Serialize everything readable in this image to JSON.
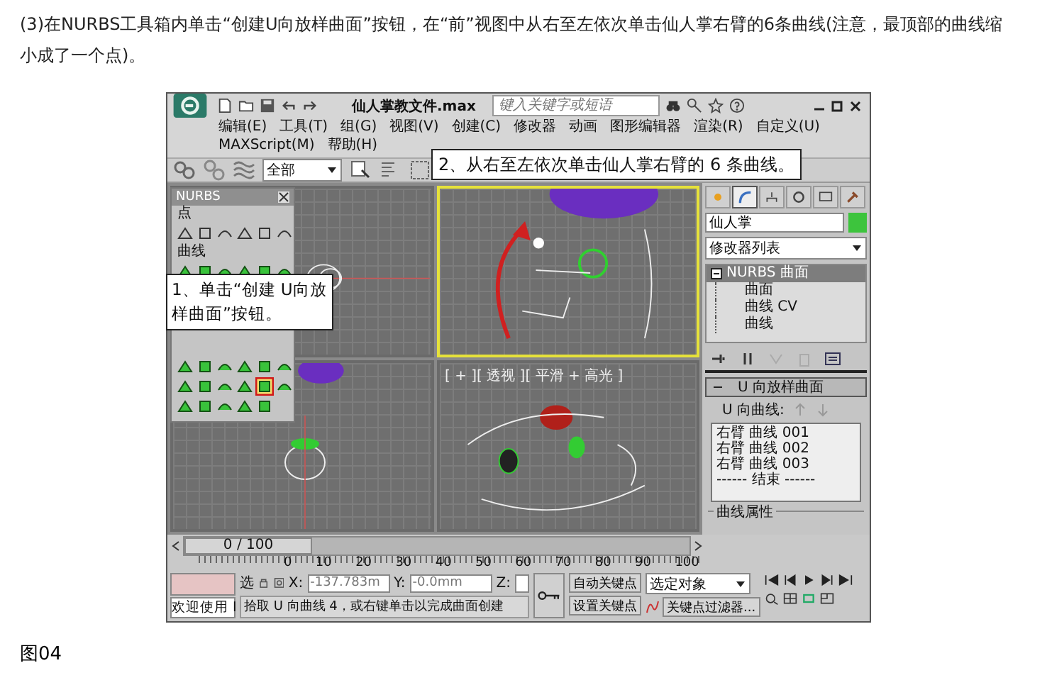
{
  "intro": "(3)在NURBS工具箱内单击“创建U向放样曲面”按钮，在“前”视图中从右至左依次单击仙人掌右臂的6条曲线(注意，最顶部的曲线缩小成了一个点)。",
  "app": {
    "title": "仙人掌教文件.max",
    "search": {
      "placeholder": "键入关键字或短语"
    },
    "menus": [
      "编辑(E)",
      "工具(T)",
      "组(G)",
      "视图(V)",
      "创建(C)",
      "修改器",
      "动画",
      "图形编辑器",
      "渲染(R)",
      "自定义(U)",
      "MAXScript(M)",
      "帮助(H)"
    ],
    "toolbar": {
      "selection_filter": "全部"
    },
    "toolbar_callout": "2、从右至左依次单击仙人掌右臂的 6 条曲线。",
    "toolbox_callout": "1、单击“创建 U向放样曲面”按钮。",
    "nurbs_toolbox": {
      "title": "NURBS",
      "sections": [
        {
          "label": "点",
          "tools": [
            {
              "highlighted": false
            },
            {
              "highlighted": false
            },
            {
              "highlighted": false
            },
            {
              "highlighted": false
            },
            {
              "highlighted": false
            },
            {
              "highlighted": false
            }
          ]
        },
        {
          "label": "曲线",
          "tools": [
            {
              "highlighted": false
            },
            {
              "highlighted": false
            },
            {
              "highlighted": false
            },
            {
              "highlighted": false
            },
            {
              "highlighted": false
            },
            {
              "highlighted": false
            }
          ]
        },
        {
          "tools": [
            {
              "highlighted": false
            },
            {
              "highlighted": false
            },
            {
              "highlighted": false
            },
            {
              "highlighted": false
            },
            {
              "highlighted": false
            },
            {
              "highlighted": false
            },
            {
              "highlighted": false
            },
            {
              "highlighted": false
            },
            {
              "highlighted": false
            },
            {
              "highlighted": false
            },
            {
              "highlighted": true
            },
            {
              "highlighted": false
            },
            {
              "highlighted": false
            },
            {
              "highlighted": false
            },
            {
              "highlighted": false
            },
            {
              "highlighted": false
            },
            {
              "highlighted": false
            }
          ]
        }
      ]
    },
    "viewports": [
      {
        "kind": "top",
        "selected": false
      },
      {
        "kind": "front",
        "selected": true
      },
      {
        "kind": "left",
        "selected": false
      },
      {
        "kind": "perspective",
        "selected": false,
        "label": "[ + ][ 透视 ][ 平滑 + 高光 ]"
      }
    ],
    "command_panel": {
      "tabs": [
        {
          "selected": false
        },
        {
          "selected": true
        },
        {
          "selected": false
        },
        {
          "selected": false
        },
        {
          "selected": false
        },
        {
          "selected": false
        }
      ],
      "object_name": "仙人掌",
      "modifier_list": "修改器列表",
      "stack": [
        {
          "label": "NURBS 曲面",
          "selected": true,
          "expanded": true,
          "children": [
            {
              "label": "曲面",
              "selected": false
            },
            {
              "label": "曲线 CV",
              "selected": false
            },
            {
              "label": "曲线",
              "selected": false
            }
          ]
        }
      ],
      "rollout": {
        "title": "U 向放样曲面",
        "expanded": true,
        "curves_label": "U 向曲线:",
        "curves": [
          "右臂 曲线 001",
          "右臂 曲线 002",
          "右臂 曲线 003",
          "------ 结束 ------"
        ]
      },
      "group_title": "曲线属性"
    },
    "timeline": {
      "position": "0 / 100",
      "level": 0,
      "ticks": [
        "0",
        "10",
        "20",
        "30",
        "40",
        "50",
        "60",
        "70",
        "80",
        "90",
        "100"
      ]
    },
    "status": {
      "listener": "欢迎使用 I",
      "select_label": "选",
      "x_label": "X:",
      "x": "-137.783m",
      "y_label": "Y:",
      "y": "-0.0mm",
      "z_label": "Z:",
      "prompt": "拾取 U 向曲线 4，或右键单击以完成曲面创建",
      "auto_key": "自动关键点",
      "set_key": "设置关键点",
      "key_target": "选定对象",
      "key_filters": "关键点过滤器..."
    }
  },
  "caption": "图04"
}
